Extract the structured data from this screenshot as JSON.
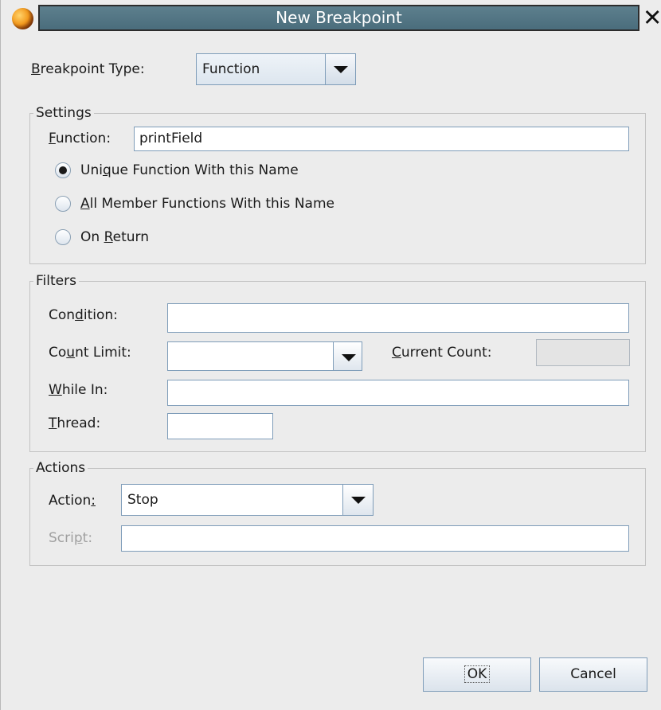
{
  "window": {
    "title": "New Breakpoint",
    "close_glyph": "✕"
  },
  "breakpoint_type": {
    "label_mnemonic": "B",
    "label_rest": "reakpoint Type:",
    "value": "Function"
  },
  "settings": {
    "legend": "Settings",
    "function_label_mnemonic": "F",
    "function_label_rest": "unction:",
    "function_value": "printField",
    "options": [
      {
        "pre": "Uni",
        "mn": "q",
        "post": "ue Function With this Name",
        "checked": true
      },
      {
        "pre": "",
        "mn": "A",
        "post": "ll Member Functions With this Name",
        "checked": false
      },
      {
        "pre": "On ",
        "mn": "R",
        "post": "eturn",
        "checked": false
      }
    ]
  },
  "filters": {
    "legend": "Filters",
    "condition_pre": "Con",
    "condition_mn": "d",
    "condition_post": "ition:",
    "condition_value": "",
    "count_limit_pre": "Co",
    "count_limit_mn": "u",
    "count_limit_post": "nt Limit:",
    "count_limit_value": "",
    "current_count_mn": "C",
    "current_count_post": "urrent Count:",
    "current_count_value": "",
    "while_in_mn": "W",
    "while_in_post": "hile In:",
    "while_in_value": "",
    "thread_mn": "T",
    "thread_post": "hread:",
    "thread_value": ""
  },
  "actions": {
    "legend": "Actions",
    "action_pre": "Action",
    "action_mn": "",
    "action_post": "",
    "action_label_pre": "Action",
    "action_label_u": ":",
    "action_value": "Stop",
    "script_pre": "Scri",
    "script_mn": "p",
    "script_post": "t:",
    "script_value": ""
  },
  "buttons": {
    "ok": "OK",
    "cancel": "Cancel"
  },
  "icons": {
    "app": "app-logo-icon",
    "close": "close-icon",
    "dropdown": "chevron-down-icon"
  },
  "colors": {
    "title_bar": "#4f7282",
    "dialog_bg": "#ececec",
    "field_border": "#7f9db9"
  }
}
